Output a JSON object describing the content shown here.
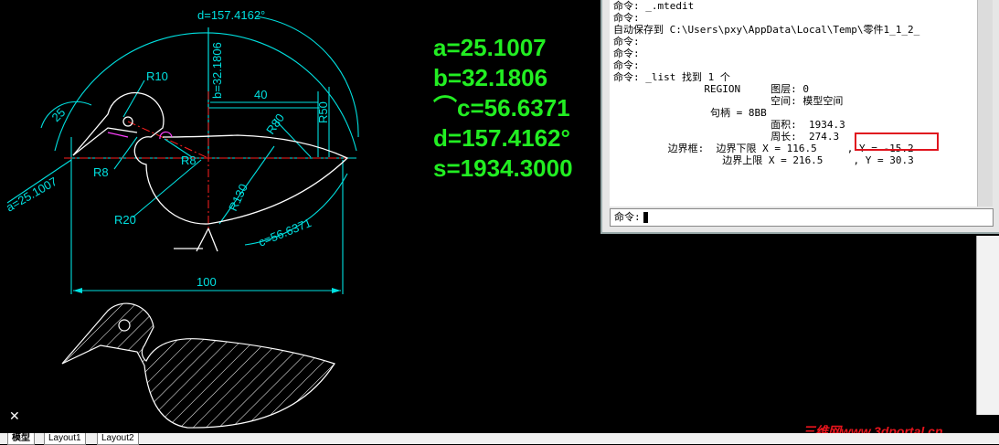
{
  "drawing": {
    "dims": {
      "angle_d": "d=157.4162°",
      "r10": "R10",
      "r25": "25",
      "b_dim": "b=32.1806",
      "dim_40": "40",
      "r80": "R80",
      "r50": "R50",
      "r8_left": "R8",
      "r8_right": "R8",
      "a_dim": "a=25.1007",
      "r130": "R130",
      "r20": "R20",
      "c_dim": "c=56.6371",
      "dim_100": "100"
    },
    "results": {
      "a": "a=25.1007",
      "b": "b=32.1806",
      "c": "⌒c=56.6371",
      "d": "d=157.4162°",
      "s": "s=1934.3000"
    }
  },
  "command_window": {
    "history": [
      "命令: _.mtedit",
      "命令:",
      "自动保存到 C:\\Users\\pxy\\AppData\\Local\\Temp\\零件1_1_2_",
      "",
      "命令:",
      "命令:",
      "命令:",
      "命令: _list 找到 1 个",
      "",
      "               REGION     图层: 0",
      "                          空间: 模型空间",
      "                句柄 = 8BB",
      "                          面积:  1934.3",
      "                          周长:  274.3",
      "         边界框:  边界下限 X = 116.5     , Y = -15.2",
      "                  边界上限 X = 216.5     , Y = 30.3"
    ],
    "prompt": "命令:"
  },
  "tabs": {
    "model": "模型",
    "layout1": "Layout1",
    "layout2": "Layout2"
  },
  "close_glyph": "✕",
  "watermark": "三维网www.3dportal.cn"
}
